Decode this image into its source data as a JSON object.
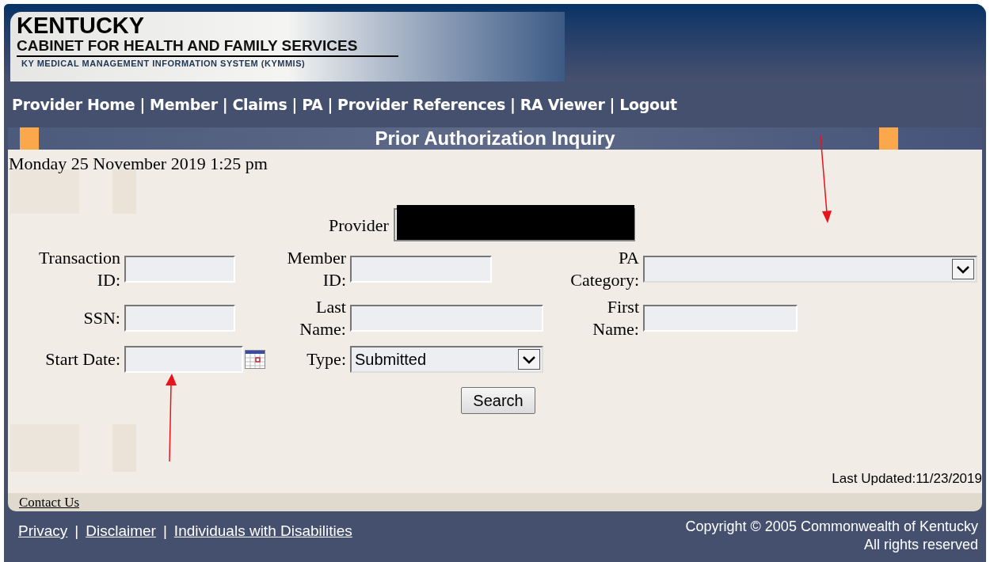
{
  "header": {
    "title": "KENTUCKY",
    "subtitle": "CABINET FOR HEALTH AND FAMILY SERVICES",
    "system": "KY MEDICAL MANAGEMENT INFORMATION SYSTEM (KYMMIS)"
  },
  "nav": [
    {
      "label": "Provider Home"
    },
    {
      "label": "Member"
    },
    {
      "label": "Claims"
    },
    {
      "label": "PA"
    },
    {
      "label": "Provider References"
    },
    {
      "label": "RA Viewer"
    },
    {
      "label": "Logout"
    }
  ],
  "nav_separator": "|",
  "page_title": "Prior Authorization Inquiry",
  "datetime": "Monday 25 November 2019 1:25 pm",
  "provider": {
    "label": "Provider",
    "redacted": true
  },
  "form_rows": [
    [
      {
        "kind": "text",
        "label": "Transaction ID:"
      },
      {
        "kind": "text",
        "label": "Member ID:"
      },
      {
        "kind": "select",
        "label": "PA Category:"
      }
    ],
    [
      {
        "kind": "text",
        "label": "SSN:"
      },
      {
        "kind": "text",
        "label": "Last Name:"
      },
      {
        "kind": "text",
        "label": "First Name:"
      }
    ],
    [
      {
        "kind": "date",
        "label": "Start Date:"
      },
      {
        "kind": "select",
        "label": "Type:",
        "value": "Submitted"
      }
    ]
  ],
  "search_button": "Search",
  "last_updated": "Last Updated:11/23/2019",
  "contact": "Contact Us",
  "footer_links": [
    {
      "label": "Privacy"
    },
    {
      "label": "Disclaimer"
    },
    {
      "label": "Individuals with Disabilities"
    }
  ],
  "footer_separator": "|",
  "copyright": [
    "Copyright © 2005 Commonwealth of Kentucky",
    "All rights reserved"
  ]
}
